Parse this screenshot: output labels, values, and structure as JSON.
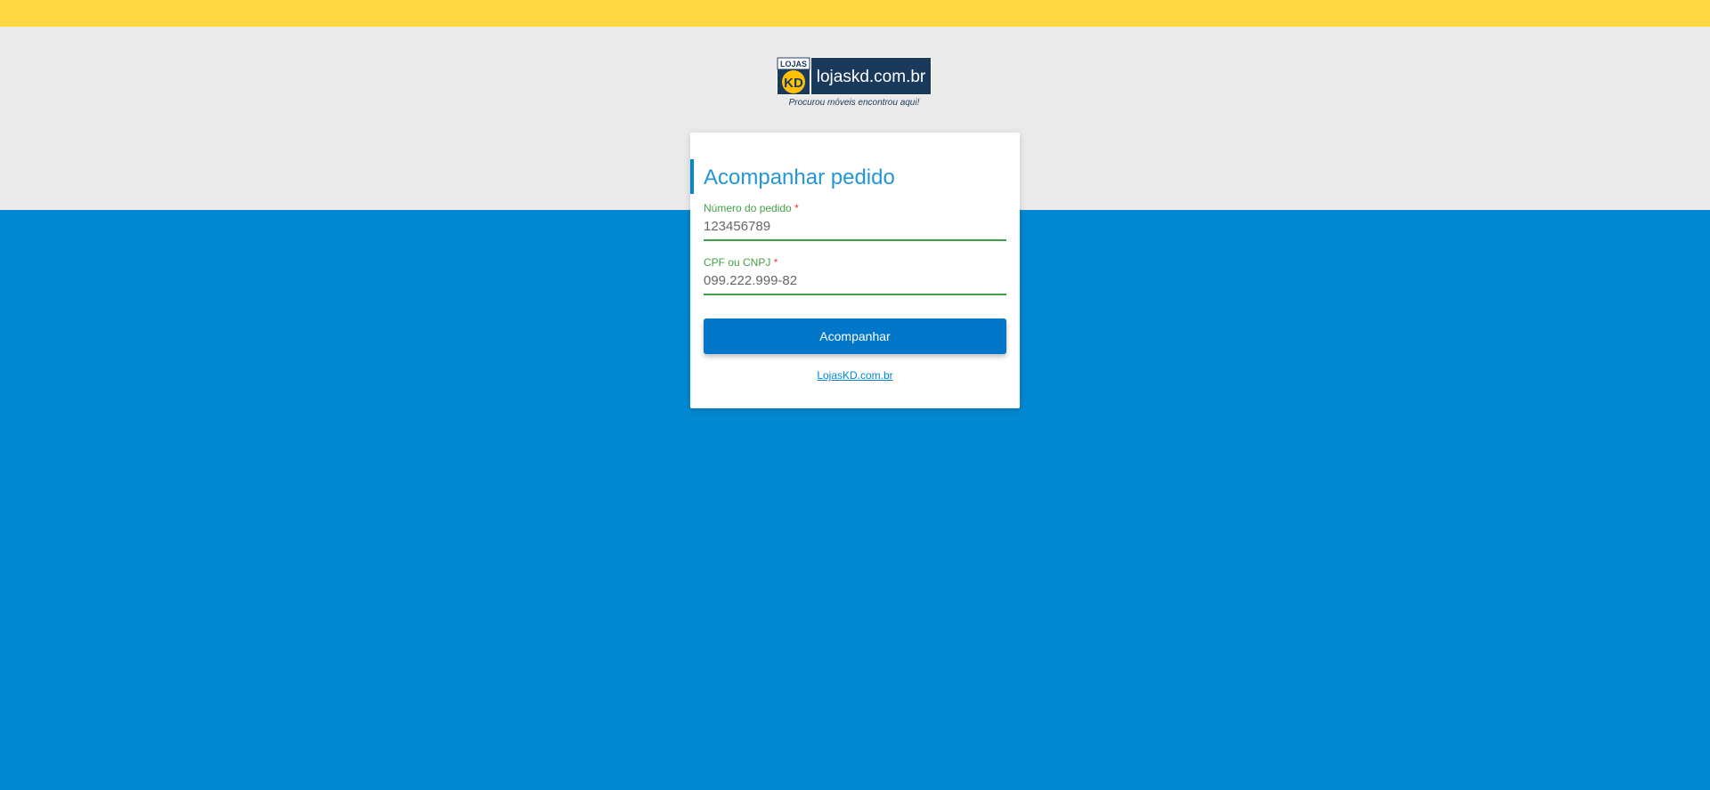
{
  "logo": {
    "brand_small": "LOJAS",
    "brand_mark": "KD",
    "brand_domain": "lojaskd.com.br",
    "tagline": "Procurou móveis encontrou aqui!"
  },
  "card": {
    "title": "Acompanhar pedido",
    "order_field": {
      "label": "Número do pedido",
      "required_mark": "*",
      "value": "123456789"
    },
    "document_field": {
      "label": "CPF ou CNPJ",
      "required_mark": "*",
      "value": "099.222.999-82"
    },
    "submit_label": "Acompanhar",
    "footer_link": "LojasKD.com.br"
  },
  "colors": {
    "top_bar": "#ffd740",
    "gray_band": "#eaeaea",
    "background": "#0288d1",
    "accent": "#0288d1",
    "valid": "#43a047",
    "button": "#0277c9"
  }
}
